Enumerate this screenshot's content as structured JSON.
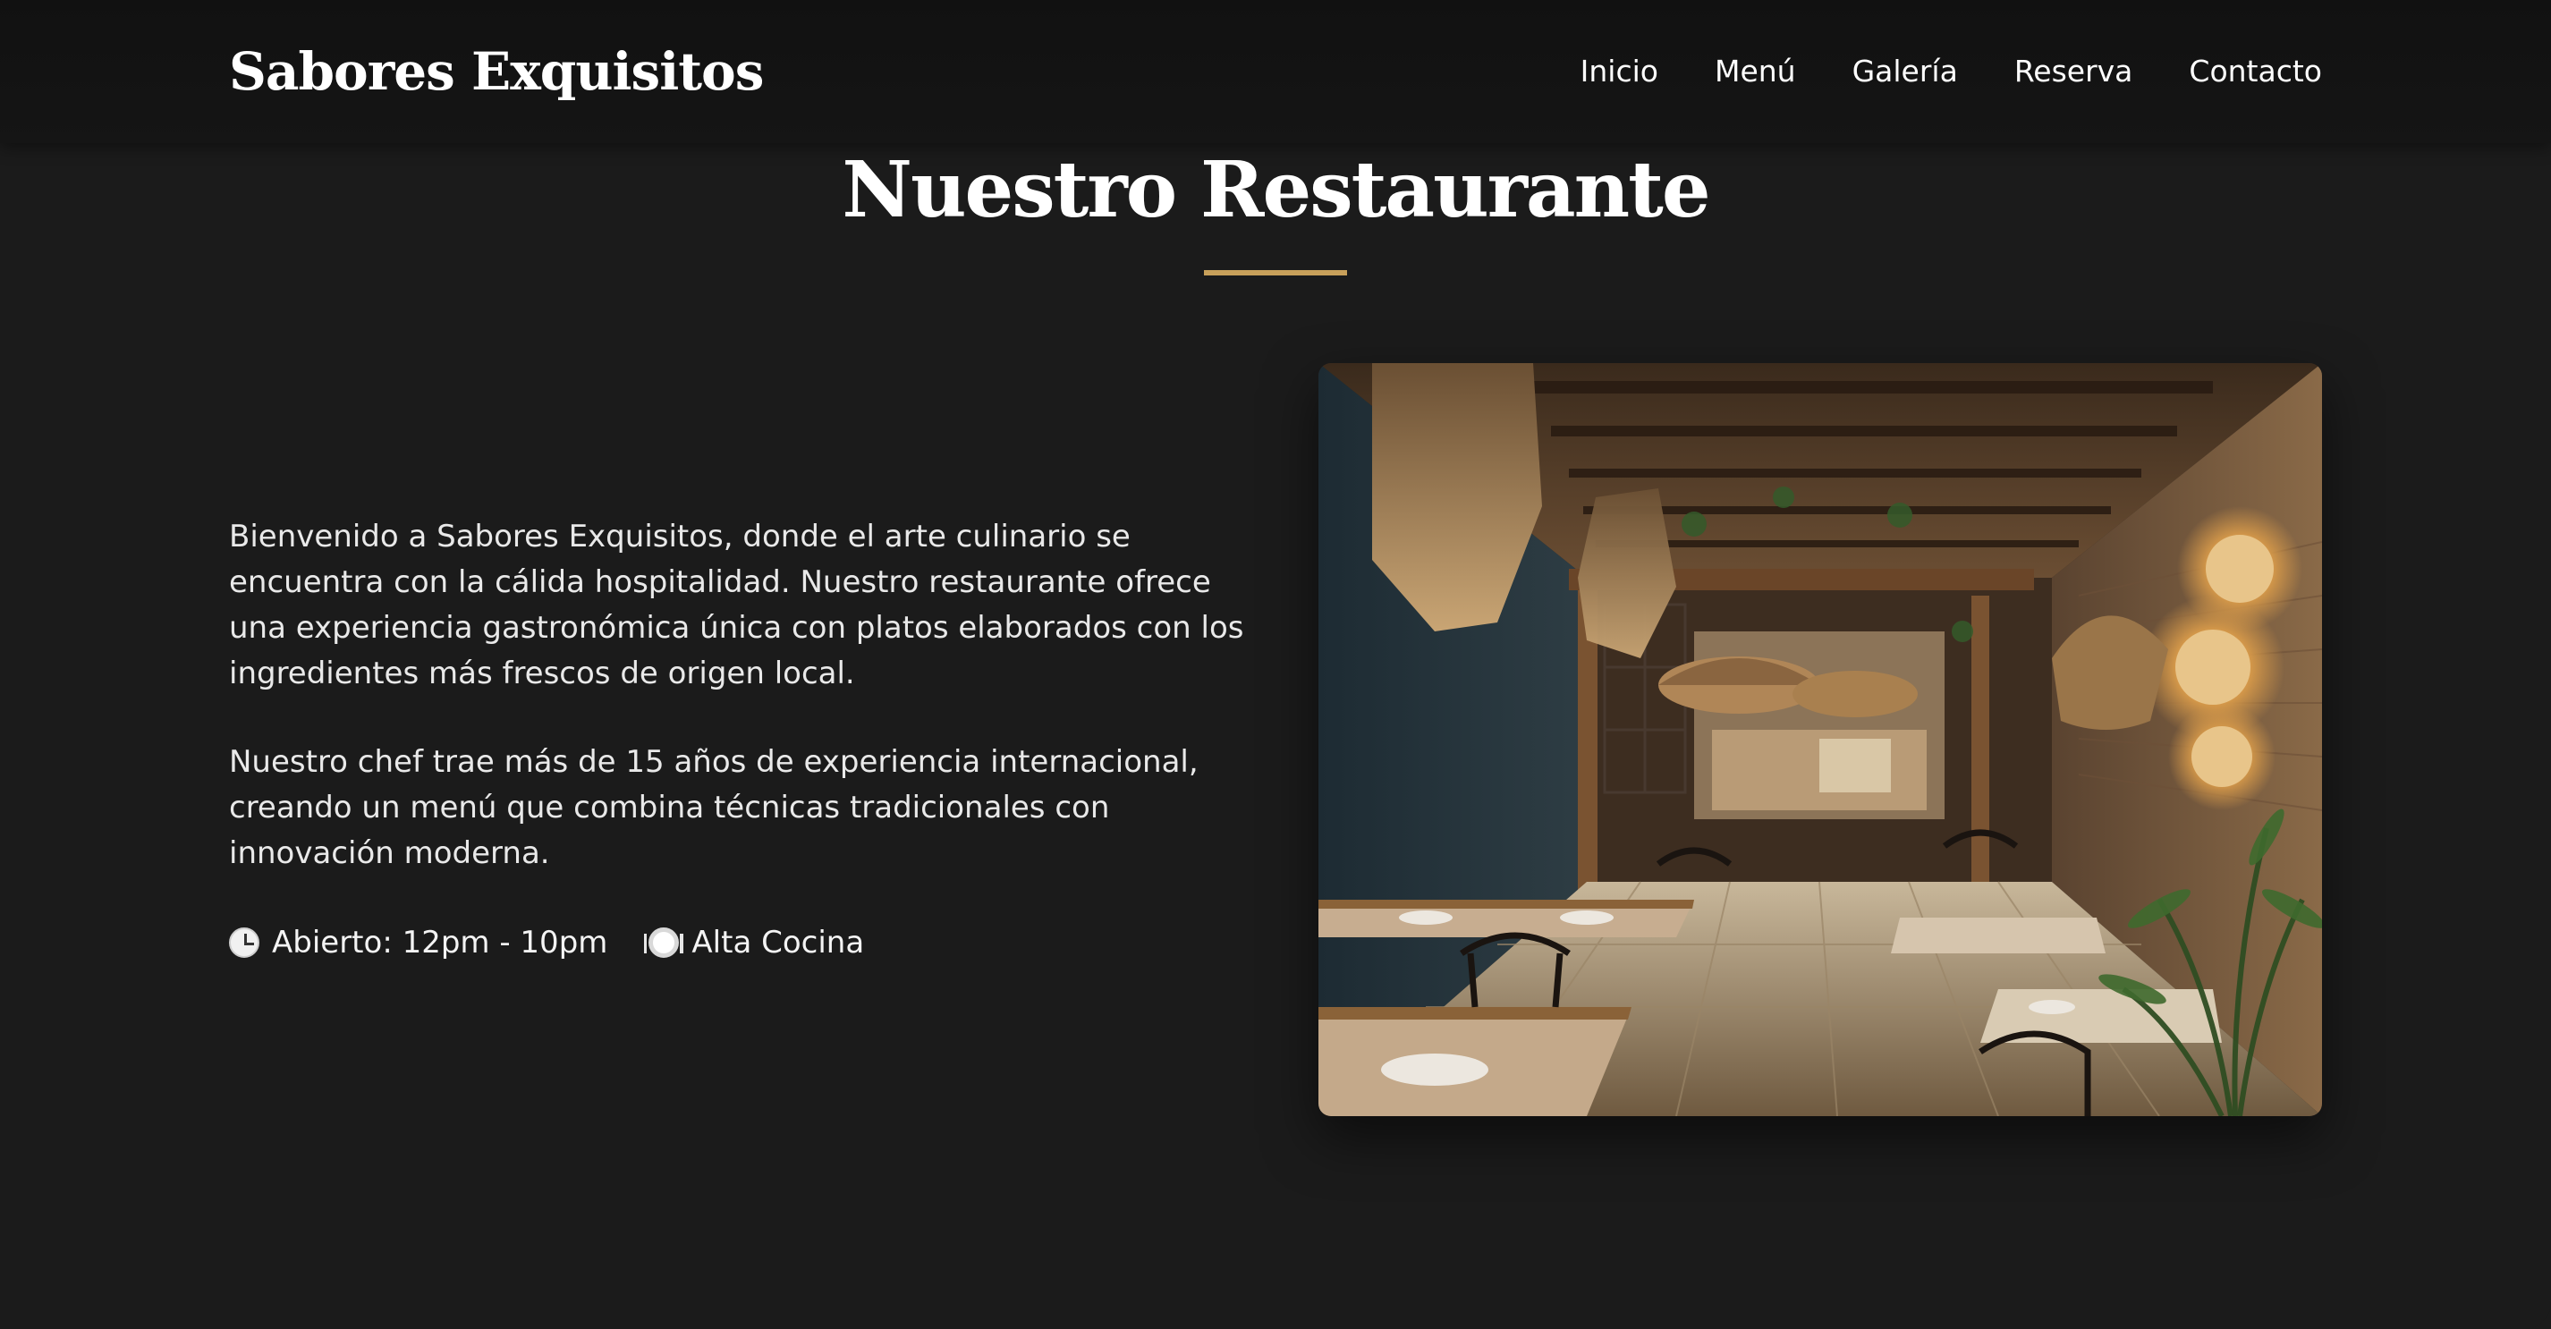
{
  "header": {
    "brand": "Sabores Exquisitos",
    "nav": [
      "Inicio",
      "Menú",
      "Galería",
      "Reserva",
      "Contacto"
    ]
  },
  "section": {
    "title": "Nuestro Restaurante",
    "paragraphs": [
      "Bienvenido a Sabores Exquisitos, donde el arte culinario se encuentra con la cálida hospitalidad. Nuestro restaurante ofrece una experiencia gastronómica única con platos elaborados con los ingredientes más frescos de origen local.",
      "Nuestro chef trae más de 15 años de experiencia internacional, creando un menú que combina técnicas tradicionales con innovación moderna."
    ],
    "meta": [
      {
        "icon": "clock-icon",
        "text": "Abierto: 12pm - 10pm"
      },
      {
        "icon": "plate-icon",
        "text": "Alta Cocina"
      }
    ]
  },
  "colors": {
    "background": "#1b1b1b",
    "header": "#131313",
    "accent": "#c8a05a",
    "text": "#ffffff"
  }
}
